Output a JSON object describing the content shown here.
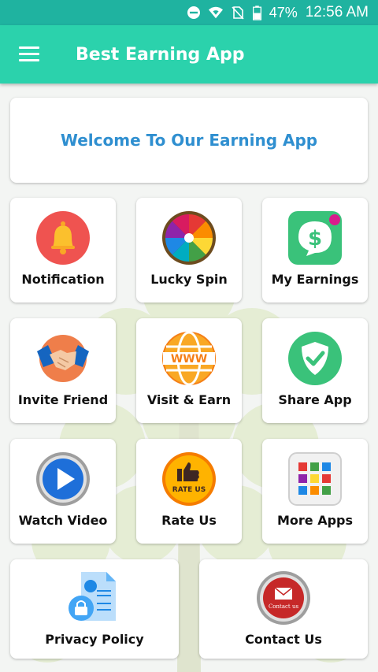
{
  "status_bar": {
    "battery": "47%",
    "time": "12:56 AM",
    "icons": [
      "dnd-icon",
      "wifi-icon",
      "no-sim-icon",
      "battery-icon"
    ]
  },
  "app_bar": {
    "title": "Best Earning App",
    "menu_icon": "hamburger-menu-icon"
  },
  "welcome": {
    "text": "Welcome To Our Earning App"
  },
  "tiles": [
    {
      "label": "Notification",
      "icon": "bell-icon"
    },
    {
      "label": "Lucky Spin",
      "icon": "spin-wheel-icon"
    },
    {
      "label": "My Earnings",
      "icon": "dollar-chat-icon"
    },
    {
      "label": "Invite Friend",
      "icon": "handshake-icon"
    },
    {
      "label": "Visit & Earn",
      "icon": "www-globe-icon"
    },
    {
      "label": "Share App",
      "icon": "shield-check-icon"
    },
    {
      "label": "Watch Video",
      "icon": "play-button-icon"
    },
    {
      "label": "Rate Us",
      "icon": "thumbs-up-icon"
    },
    {
      "label": "More Apps",
      "icon": "app-grid-icon"
    },
    {
      "label": "Privacy Policy",
      "icon": "privacy-document-icon"
    },
    {
      "label": "Contact Us",
      "icon": "mail-icon"
    }
  ],
  "icon_text": {
    "www": "WWW",
    "rate_badge": "RATE US",
    "contact_badge": "Contact us"
  },
  "colors": {
    "status_bar": "#1fb3a0",
    "app_bar": "#2bd2ac",
    "welcome_text": "#2f8fd0"
  }
}
